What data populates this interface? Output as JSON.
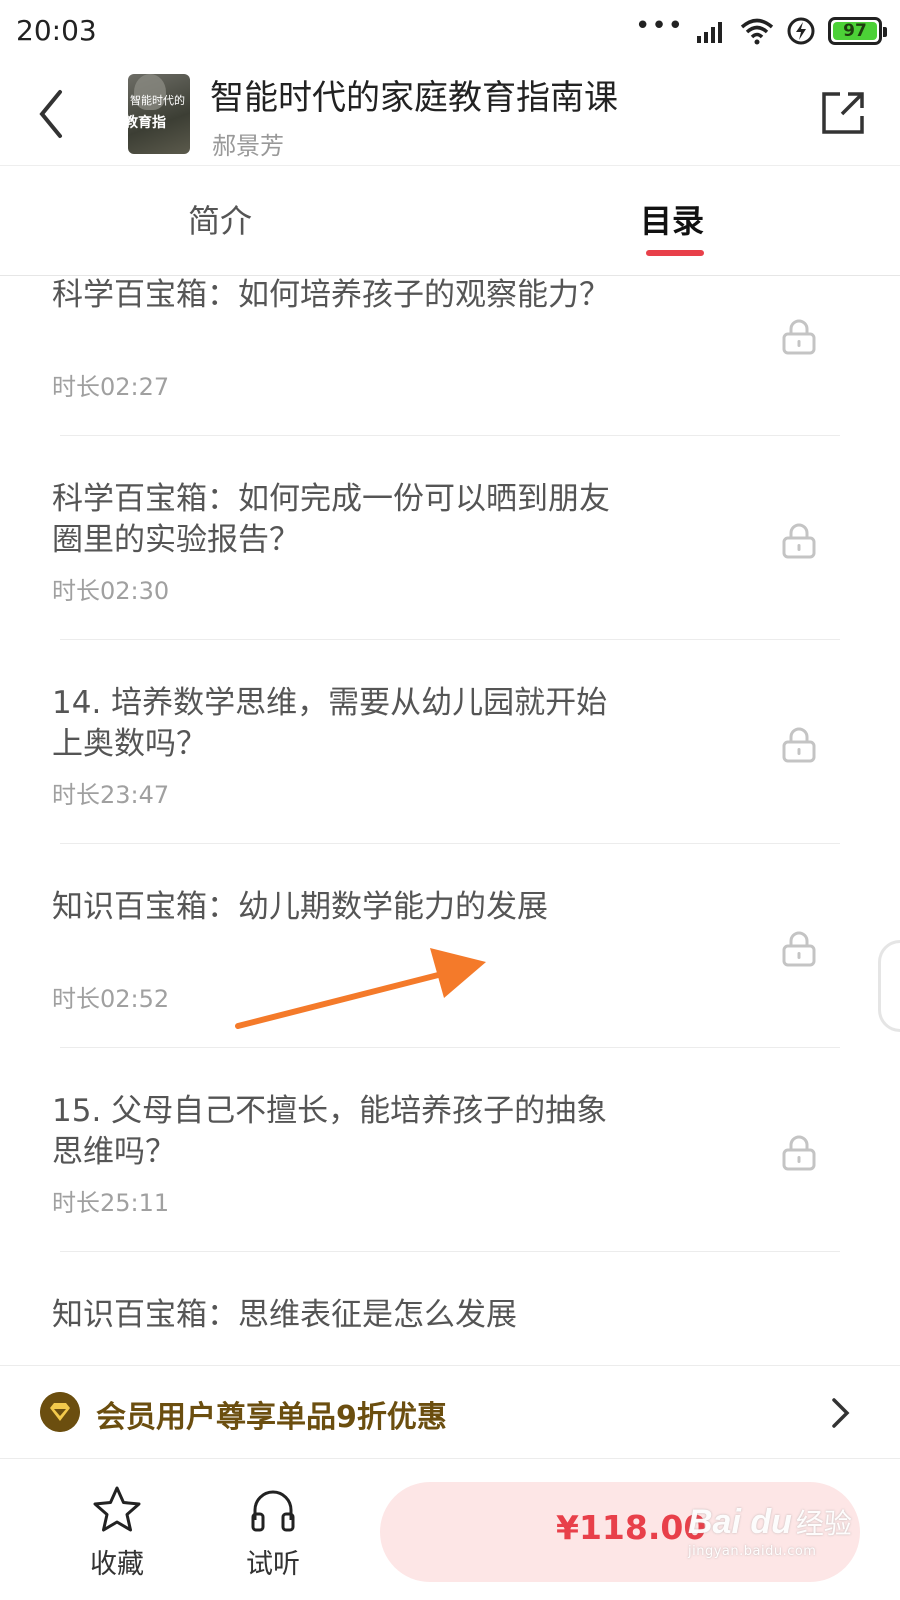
{
  "status_bar": {
    "time": "20:03",
    "battery": "97",
    "icons": [
      "more-dots-icon",
      "signal-icon",
      "wifi-icon",
      "charging-icon",
      "battery-icon"
    ]
  },
  "header": {
    "title": "智能时代的家庭教育指南课",
    "author": "郝景芳",
    "cover_line1": "智能时代的",
    "cover_line2": "教育指"
  },
  "tabs": [
    {
      "label": "简介",
      "active": false
    },
    {
      "label": "目录",
      "active": true
    }
  ],
  "items": [
    {
      "title": "科学百宝箱：如何培养孩子的观察能力？",
      "duration": "时长02:27",
      "locked": true
    },
    {
      "title": "科学百宝箱：如何完成一份可以晒到朋友圈里的实验报告？",
      "duration": "时长02:30",
      "locked": true
    },
    {
      "title": "14. 培养数学思维，需要从幼儿园就开始上奥数吗？",
      "duration": "时长23:47",
      "locked": true
    },
    {
      "title": "知识百宝箱：幼儿期数学能力的发展",
      "duration": "时长02:52",
      "locked": true
    },
    {
      "title": "15. 父母自己不擅长，能培养孩子的抽象思维吗？",
      "duration": "时长25:11",
      "locked": true
    },
    {
      "title": "知识百宝箱：思维表征是怎么发展",
      "duration": "",
      "locked": true
    }
  ],
  "member_banner": {
    "text": "会员用户尊享单品9折优惠"
  },
  "bottom_bar": {
    "favorite_label": "收藏",
    "listen_label": "试听",
    "price": "¥118.00"
  },
  "watermark": {
    "logo": "Bai du",
    "cn": "经验",
    "url": "jingyan.baidu.com"
  },
  "colors": {
    "accent": "#e8404a",
    "member_gold": "#6b4e0f",
    "annotation_arrow": "#f47a2a"
  }
}
